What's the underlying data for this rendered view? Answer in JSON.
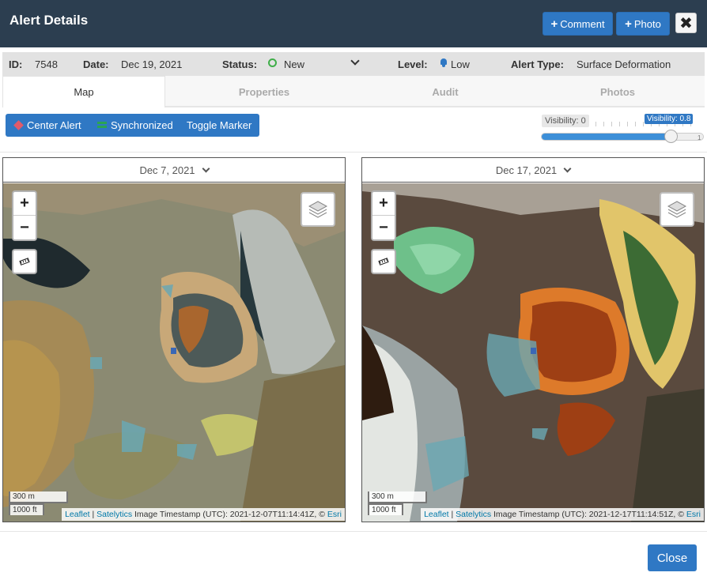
{
  "header": {
    "title": "Alert Details",
    "comment_label": "Comment",
    "photo_label": "Photo",
    "close_symbol": "✖"
  },
  "info": {
    "id_label": "ID:",
    "id": "7548",
    "date_label": "Date:",
    "date": "Dec 19, 2021",
    "status_label": "Status:",
    "status": "New",
    "level_label": "Level:",
    "level": "Low",
    "alert_type_label": "Alert Type:",
    "alert_type": "Surface Deformation"
  },
  "tabs": [
    {
      "label": "Map"
    },
    {
      "label": "Properties"
    },
    {
      "label": "Audit"
    },
    {
      "label": "Photos"
    }
  ],
  "toolbar": {
    "center_alert": "Center Alert",
    "synchronized": "Synchronized",
    "toggle_marker": "Toggle Marker"
  },
  "visibility": {
    "min_label": "Visibility: 0",
    "value_label": "Visibility: 0.8",
    "value": 0.8,
    "max": "1"
  },
  "maps": [
    {
      "date": "Dec 7, 2021",
      "scale_m": "300 m",
      "scale_ft": "1000 ft",
      "attrib_leaflet": "Leaflet",
      "attrib_sep": " | ",
      "attrib_satelytics": "Satelytics",
      "attrib_text": " Image Timestamp (UTC): 2021-12-07T11:14:41Z, © ",
      "attrib_esri": "Esri"
    },
    {
      "date": "Dec 17, 2021",
      "scale_m": "300 m",
      "scale_ft": "1000 ft",
      "attrib_leaflet": "Leaflet",
      "attrib_sep": " | ",
      "attrib_satelytics": "Satelytics",
      "attrib_text": " Image Timestamp (UTC): 2021-12-17T11:14:51Z, © ",
      "attrib_esri": "Esri"
    }
  ],
  "zoom": {
    "in": "+",
    "out": "−"
  },
  "footer": {
    "close_label": "Close"
  },
  "colors": {
    "header_bg": "#2c3e50",
    "primary": "#2f78c4",
    "status_green": "#3fae49"
  }
}
